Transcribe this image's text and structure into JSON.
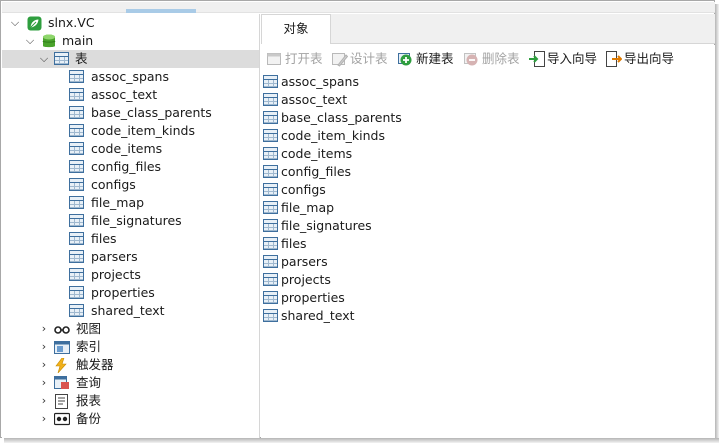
{
  "tree": {
    "connection": {
      "label": "slnx.VC",
      "icon": "leaf-connection-icon"
    },
    "database": {
      "label": "main",
      "icon": "database-icon"
    },
    "tables_folder": {
      "label": "表",
      "icon": "table-icon"
    },
    "tables": [
      "assoc_spans",
      "assoc_text",
      "base_class_parents",
      "code_item_kinds",
      "code_items",
      "config_files",
      "configs",
      "file_map",
      "file_signatures",
      "files",
      "parsers",
      "projects",
      "properties",
      "shared_text"
    ],
    "folders": [
      {
        "label": "视图",
        "icon": "glasses-view-icon"
      },
      {
        "label": "索引",
        "icon": "index-icon"
      },
      {
        "label": "触发器",
        "icon": "lightning-trigger-icon"
      },
      {
        "label": "查询",
        "icon": "query-icon"
      },
      {
        "label": "报表",
        "icon": "report-icon"
      },
      {
        "label": "备份",
        "icon": "backup-icon"
      }
    ]
  },
  "tabs": [
    {
      "label": "对象"
    }
  ],
  "toolbar": {
    "open_table": {
      "label": "打开表",
      "icon": "open-table-icon",
      "enabled": false
    },
    "design_table": {
      "label": "设计表",
      "icon": "design-table-icon",
      "enabled": false
    },
    "new_table": {
      "label": "新建表",
      "icon": "plus-circle-icon",
      "enabled": true
    },
    "delete_table": {
      "label": "删除表",
      "icon": "minus-circle-icon",
      "enabled": false
    },
    "import_wizard": {
      "label": "导入向导",
      "icon": "import-icon",
      "enabled": true
    },
    "export_wizard": {
      "label": "导出向导",
      "icon": "export-icon",
      "enabled": true
    }
  },
  "objects": [
    "assoc_spans",
    "assoc_text",
    "base_class_parents",
    "code_item_kinds",
    "code_items",
    "config_files",
    "configs",
    "file_map",
    "file_signatures",
    "files",
    "parsers",
    "projects",
    "properties",
    "shared_text"
  ],
  "colors": {
    "accent_green": "#2e9e3e",
    "selection": "#dcdcdc",
    "table_icon": "#3e6f9e",
    "disabled_text": "#a3a3a3"
  }
}
